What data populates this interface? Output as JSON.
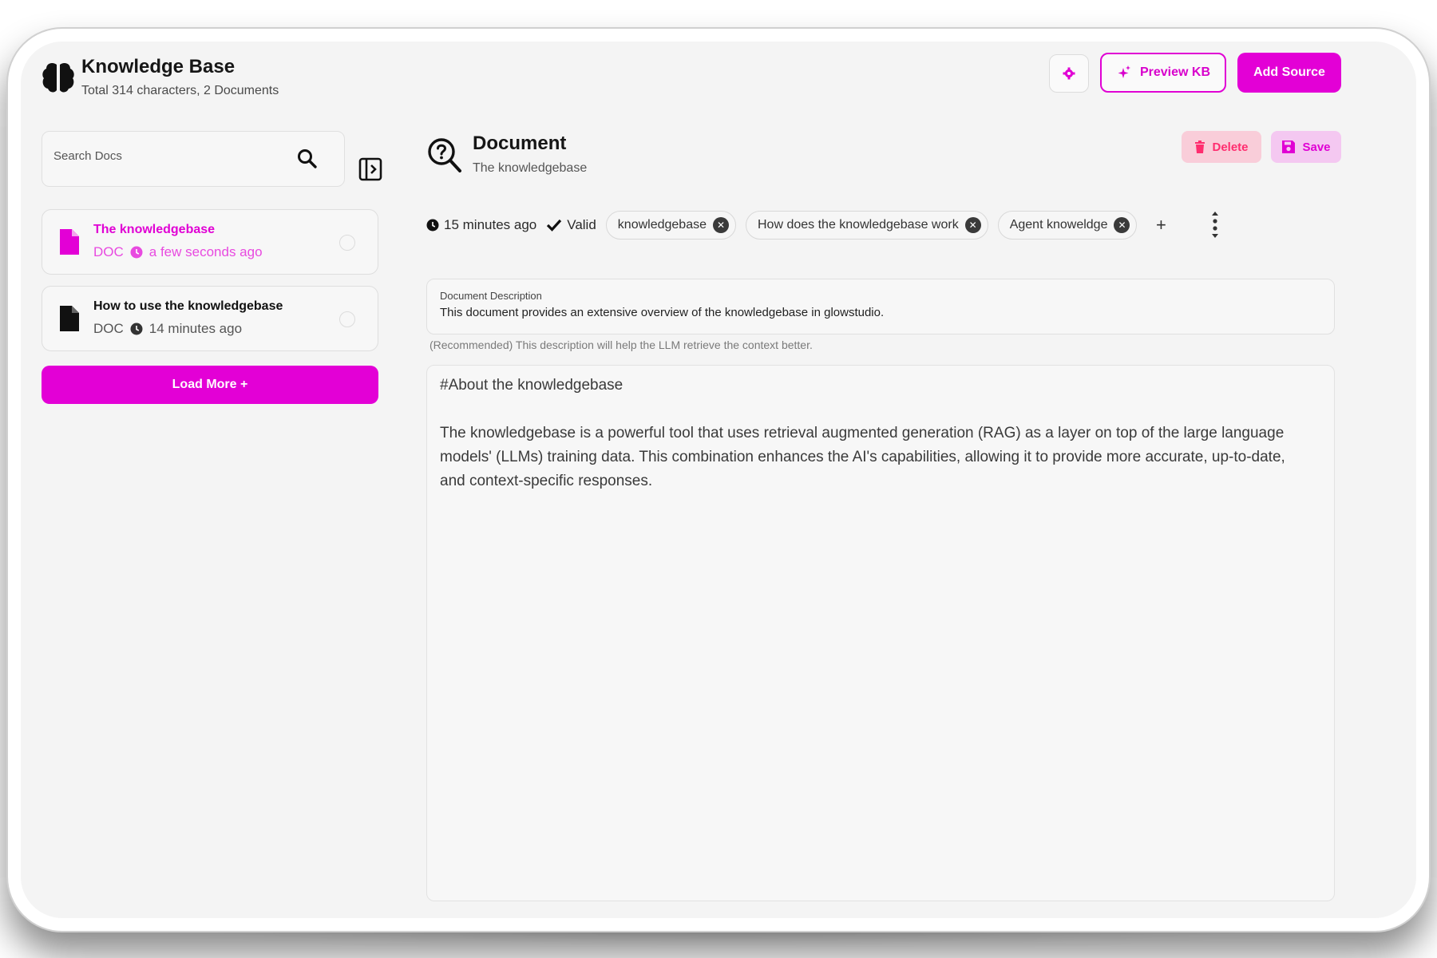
{
  "header": {
    "title": "Knowledge Base",
    "subtitle": "Total 314 characters, 2 Documents",
    "preview_label": "Preview KB",
    "add_source_label": "Add Source"
  },
  "sidebar": {
    "search_placeholder": "Search Docs",
    "documents": [
      {
        "title": "The knowledgebase",
        "type": "DOC",
        "time": "a few seconds ago",
        "selected": true
      },
      {
        "title": "How to use the knowledgebase",
        "type": "DOC",
        "time": "14 minutes ago",
        "selected": false
      }
    ],
    "load_more_label": "Load More +"
  },
  "document": {
    "title": "Document",
    "subtitle": "The knowledgebase",
    "delete_label": "Delete",
    "save_label": "Save",
    "updated": "15 minutes ago",
    "status": "Valid",
    "tags": [
      "knowledgebase",
      "How does the knowledgebase work",
      "Agent knoweldge"
    ],
    "add_tag": "+",
    "description_label": "Document Description",
    "description": "This document provides an extensive overview of the knowledgebase in glowstudio.",
    "description_hint": "(Recommended) This description will help the LLM retrieve the context better.",
    "content_heading": "#About the knowledgebase",
    "content_body": "The knowledgebase is a powerful tool that uses retrieval augmented generation (RAG) as a layer on top of the large language models' (LLMs) training data. This combination enhances the AI's capabilities, allowing it to provide more accurate, up-to-date, and context-specific responses."
  },
  "colors": {
    "accent": "#e300d6",
    "selected_text": "#e000d4",
    "delete_bg": "#f9cdd9",
    "delete_text": "#ff2d6f",
    "save_bg": "#f4c8f1",
    "background": "#f4f4f4"
  },
  "icons": {
    "brand": "brain-icon",
    "settings": "gear-icon",
    "preview": "sparkle-icon",
    "search": "search-icon",
    "sidebar_toggle": "sidebar-toggle-icon",
    "file": "file-icon",
    "clock": "clock-icon",
    "doc_header": "search-question-icon",
    "delete": "trash-icon",
    "save": "floppy-disk-icon",
    "valid": "check-icon",
    "tag_remove": "close-circle-icon",
    "more": "vertical-dots-icon"
  }
}
